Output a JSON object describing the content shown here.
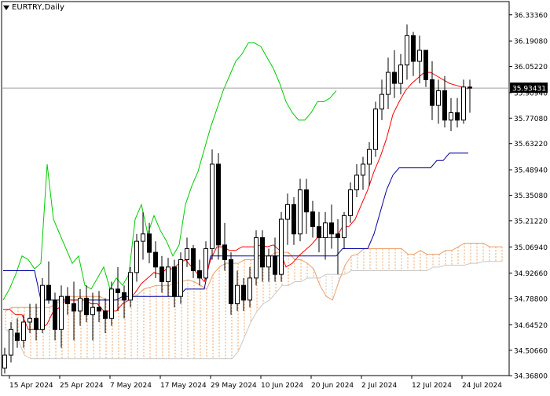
{
  "chart_data": {
    "type": "candlestick",
    "title": "EURTRY,Daily",
    "current_price": "35.93431",
    "ylim": [
      34.3688,
      36.4054
    ],
    "price_labels": [
      "36.33360",
      "36.19080",
      "36.05220",
      "35.90940",
      "35.77080",
      "35.63220",
      "35.48940",
      "35.35080",
      "35.21220",
      "35.06940",
      "34.92660",
      "34.78800",
      "34.64520",
      "34.50660",
      "34.36800"
    ],
    "x_labels": [
      {
        "label": "15 Apr 2024",
        "index": 1
      },
      {
        "label": "25 Apr 2024",
        "index": 9
      },
      {
        "label": "7 May 2024",
        "index": 17
      },
      {
        "label": "17 May 2024",
        "index": 25
      },
      {
        "label": "29 May 2024",
        "index": 33
      },
      {
        "label": "10 Jun 2024",
        "index": 41
      },
      {
        "label": "20 Jun 2024",
        "index": 49
      },
      {
        "label": "2 Jul 2024",
        "index": 57
      },
      {
        "label": "12 Jul 2024",
        "index": 65
      },
      {
        "label": "24 Jul 2024",
        "index": 73
      }
    ],
    "candles": [
      [
        34.41,
        34.52,
        34.38,
        34.48
      ],
      [
        34.48,
        34.66,
        34.44,
        34.62
      ],
      [
        34.6,
        34.68,
        34.52,
        34.56
      ],
      [
        34.56,
        34.7,
        34.52,
        34.66
      ],
      [
        34.66,
        34.76,
        34.6,
        34.68
      ],
      [
        34.68,
        34.76,
        34.56,
        34.62
      ],
      [
        34.62,
        34.9,
        34.6,
        34.86
      ],
      [
        34.86,
        34.99,
        34.76,
        34.78
      ],
      [
        34.78,
        34.82,
        34.56,
        34.62
      ],
      [
        34.62,
        34.86,
        34.52,
        34.8
      ],
      [
        34.8,
        34.85,
        34.7,
        34.76
      ],
      [
        34.76,
        34.88,
        34.56,
        34.72
      ],
      [
        34.72,
        34.84,
        34.64,
        34.79
      ],
      [
        34.79,
        34.86,
        34.66,
        34.7
      ],
      [
        34.7,
        34.82,
        34.56,
        34.74
      ],
      [
        34.74,
        34.83,
        34.66,
        34.72
      ],
      [
        34.72,
        34.79,
        34.6,
        34.68
      ],
      [
        34.68,
        34.88,
        34.64,
        34.84
      ],
      [
        34.84,
        34.96,
        34.72,
        34.82
      ],
      [
        34.82,
        34.86,
        34.68,
        34.78
      ],
      [
        34.78,
        34.96,
        34.74,
        34.93
      ],
      [
        34.93,
        35.14,
        34.88,
        35.1
      ],
      [
        35.1,
        35.26,
        35.0,
        35.14
      ],
      [
        35.14,
        35.2,
        34.98,
        35.04
      ],
      [
        35.04,
        35.1,
        34.9,
        34.96
      ],
      [
        34.96,
        35.02,
        34.82,
        34.88
      ],
      [
        34.88,
        35.01,
        34.8,
        34.96
      ],
      [
        34.96,
        35.0,
        34.74,
        34.8
      ],
      [
        34.8,
        35.04,
        34.76,
        35.0
      ],
      [
        35.0,
        35.12,
        34.96,
        35.06
      ],
      [
        35.06,
        35.08,
        34.9,
        34.94
      ],
      [
        34.94,
        35.0,
        34.86,
        34.9
      ],
      [
        34.9,
        35.1,
        34.88,
        35.06
      ],
      [
        35.06,
        35.6,
        35.0,
        35.52
      ],
      [
        35.52,
        35.58,
        35.0,
        35.08
      ],
      [
        35.08,
        35.2,
        34.94,
        35.0
      ],
      [
        35.0,
        35.04,
        34.7,
        34.76
      ],
      [
        34.76,
        34.94,
        34.72,
        34.86
      ],
      [
        34.86,
        34.9,
        34.72,
        34.78
      ],
      [
        34.78,
        34.96,
        34.74,
        34.9
      ],
      [
        34.9,
        35.16,
        34.86,
        35.12
      ],
      [
        35.12,
        35.16,
        34.88,
        34.96
      ],
      [
        34.96,
        35.06,
        34.88,
        35.02
      ],
      [
        35.02,
        35.12,
        34.88,
        34.92
      ],
      [
        34.92,
        35.26,
        34.88,
        35.22
      ],
      [
        35.22,
        35.36,
        35.08,
        35.3
      ],
      [
        35.3,
        35.34,
        35.08,
        35.14
      ],
      [
        35.14,
        35.44,
        35.1,
        35.38
      ],
      [
        35.38,
        35.44,
        35.14,
        35.26
      ],
      [
        35.26,
        35.32,
        35.12,
        35.18
      ],
      [
        35.18,
        35.26,
        35.04,
        35.12
      ],
      [
        35.12,
        35.26,
        35.0,
        35.2
      ],
      [
        35.2,
        35.3,
        35.06,
        35.14
      ],
      [
        35.14,
        35.22,
        34.92,
        35.12
      ],
      [
        35.12,
        35.26,
        35.06,
        35.24
      ],
      [
        35.24,
        35.42,
        35.2,
        35.38
      ],
      [
        35.38,
        35.52,
        35.34,
        35.46
      ],
      [
        35.46,
        35.56,
        35.38,
        35.52
      ],
      [
        35.52,
        35.64,
        35.4,
        35.6
      ],
      [
        35.6,
        35.86,
        35.56,
        35.82
      ],
      [
        35.82,
        35.98,
        35.76,
        35.9
      ],
      [
        35.9,
        36.1,
        35.82,
        36.02
      ],
      [
        36.02,
        36.14,
        35.88,
        35.96
      ],
      [
        35.96,
        36.12,
        35.9,
        36.06
      ],
      [
        36.06,
        36.28,
        35.98,
        36.22
      ],
      [
        36.22,
        36.24,
        36.0,
        36.08
      ],
      [
        36.08,
        36.22,
        35.96,
        36.14
      ],
      [
        36.14,
        36.14,
        35.94,
        35.98
      ],
      [
        35.98,
        36.08,
        35.76,
        35.84
      ],
      [
        35.84,
        35.98,
        35.74,
        35.92
      ],
      [
        35.92,
        36.0,
        35.72,
        35.76
      ],
      [
        35.76,
        35.88,
        35.7,
        35.8
      ],
      [
        35.8,
        35.88,
        35.72,
        35.76
      ],
      [
        35.76,
        35.98,
        35.74,
        35.94
      ],
      [
        35.94,
        35.98,
        35.8,
        35.934
      ]
    ],
    "tenkan": [
      34.73,
      34.73,
      34.7,
      34.7,
      34.62,
      34.62,
      34.62,
      34.65,
      34.72,
      34.74,
      34.78,
      34.78,
      34.78,
      34.78,
      34.76,
      34.76,
      34.72,
      34.72,
      34.72,
      34.76,
      34.78,
      34.82,
      34.87,
      34.9,
      34.93,
      34.92,
      34.95,
      34.95,
      34.98,
      35.0,
      34.96,
      34.92,
      34.88,
      35.0,
      35.07,
      35.07,
      35.05,
      35.05,
      35.07,
      35.07,
      35.07,
      35.08,
      35.07,
      35.08,
      35.05,
      34.96,
      34.98,
      35.02,
      35.05,
      35.08,
      35.12,
      35.12,
      35.12,
      35.12,
      35.18,
      35.18,
      35.22,
      35.3,
      35.38,
      35.48,
      35.56,
      35.66,
      35.79,
      35.86,
      35.92,
      35.96,
      35.99,
      36.02,
      36.02,
      36.0,
      35.98,
      35.96,
      35.95,
      35.94,
      35.93
    ],
    "kijun": [
      34.94,
      34.94,
      34.94,
      34.94,
      34.94,
      34.94,
      34.78,
      34.78,
      34.78,
      34.78,
      34.78,
      34.78,
      34.78,
      34.78,
      34.78,
      34.78,
      34.78,
      34.78,
      34.78,
      34.8,
      34.8,
      34.8,
      34.8,
      34.8,
      34.8,
      34.8,
      34.8,
      34.8,
      34.8,
      34.84,
      34.84,
      34.84,
      34.84,
      35.02,
      35.02,
      35.02,
      35.02,
      35.02,
      35.02,
      35.02,
      35.02,
      35.02,
      35.02,
      35.02,
      35.02,
      35.02,
      35.02,
      35.02,
      35.02,
      35.02,
      35.02,
      35.02,
      35.02,
      35.02,
      35.06,
      35.06,
      35.06,
      35.06,
      35.06,
      35.14,
      35.26,
      35.38,
      35.46,
      35.5,
      35.5,
      35.5,
      35.5,
      35.5,
      35.5,
      35.54,
      35.54,
      35.58,
      35.58,
      35.58,
      35.58
    ],
    "chikou": [
      34.78,
      34.84,
      34.92,
      35.02,
      35.0,
      34.95,
      34.98,
      35.52,
      35.22,
      35.14,
      35.06,
      34.98,
      35.02,
      34.86,
      34.84,
      34.9,
      34.96,
      34.84,
      34.9,
      34.86,
      34.92,
      35.22,
      35.3,
      35.14,
      35.24,
      35.16,
      35.1,
      35.02,
      35.08,
      35.3,
      35.4,
      35.48,
      35.6,
      35.72,
      35.82,
      35.92,
      36.0,
      36.08,
      36.12,
      36.18,
      36.18,
      36.16,
      36.1,
      36.04,
      35.96,
      35.86,
      35.8,
      35.76,
      35.76,
      35.8,
      35.86,
      35.86,
      35.88,
      35.92
    ],
    "senkou_a": [
      34.72,
      34.74,
      34.74,
      34.74,
      34.74,
      34.74,
      34.74,
      34.74,
      34.76,
      34.78,
      34.8,
      34.8,
      34.8,
      34.8,
      34.8,
      34.8,
      34.78,
      34.78,
      34.78,
      34.78,
      34.79,
      34.81,
      34.84,
      34.85,
      34.86,
      34.86,
      34.86,
      34.87,
      34.88,
      34.89,
      34.88,
      34.86,
      34.84,
      34.92,
      34.96,
      34.98,
      34.98,
      34.98,
      35.0,
      35.0,
      35.0,
      35.02,
      35.02,
      35.04,
      35.04,
      35.04,
      35.0,
      35.0,
      34.98,
      34.95,
      34.86,
      34.8,
      34.78,
      34.88,
      34.97,
      35.02,
      35.03,
      35.06,
      35.06,
      35.06,
      35.06,
      35.06,
      35.06,
      35.06,
      35.03,
      35.03,
      35.05,
      35.03,
      35.03,
      35.03,
      35.05,
      35.05,
      35.07,
      35.09,
      35.09,
      35.09,
      35.09,
      35.07,
      35.07,
      35.07
    ],
    "senkou_b": [
      34.62,
      34.6,
      34.56,
      34.48,
      34.46,
      34.46,
      34.46,
      34.46,
      34.46,
      34.46,
      34.46,
      34.46,
      34.46,
      34.46,
      34.46,
      34.46,
      34.46,
      34.46,
      34.46,
      34.46,
      34.46,
      34.46,
      34.46,
      34.46,
      34.46,
      34.46,
      34.46,
      34.46,
      34.46,
      34.46,
      34.46,
      34.46,
      34.46,
      34.46,
      34.46,
      34.46,
      34.46,
      34.5,
      34.58,
      34.66,
      34.72,
      34.76,
      34.78,
      34.82,
      34.86,
      34.86,
      34.88,
      34.88,
      34.9,
      34.9,
      34.9,
      34.92,
      34.92,
      34.92,
      34.92,
      34.94,
      34.94,
      34.94,
      34.94,
      34.94,
      34.94,
      34.94,
      34.94,
      34.94,
      34.94,
      34.94,
      34.94,
      34.94,
      34.96,
      34.96,
      34.97,
      34.97,
      34.97,
      34.97,
      34.98,
      34.98,
      34.99,
      34.99,
      34.99,
      34.99
    ],
    "colors": {
      "bull_body": "#ffffff",
      "bear_body": "#000000",
      "candle_line": "#000000",
      "tenkan": "#ff0000",
      "kijun": "#0000a0",
      "chikou": "#00cc00",
      "senkou_a": "#e8a070",
      "senkou_b": "#c8c8c8",
      "cloud_up": "#f0a060",
      "cloud_down": "#c8c8c8",
      "price_line": "#a0a0a0",
      "price_label_bg": "#000000"
    }
  }
}
